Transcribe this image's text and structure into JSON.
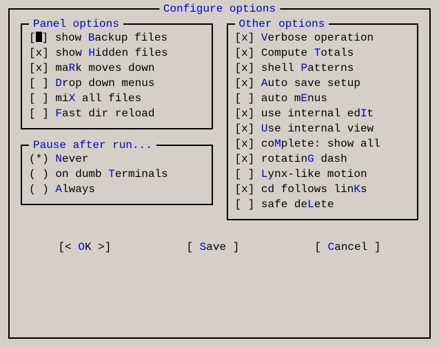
{
  "title": "Configure options",
  "panel": {
    "title": "Panel options",
    "items": [
      {
        "checked": true,
        "pre": "show ",
        "hot": "B",
        "post": "ackup files",
        "cursor": true
      },
      {
        "checked": true,
        "pre": "show ",
        "hot": "H",
        "post": "idden files"
      },
      {
        "checked": true,
        "pre": "ma",
        "hot": "R",
        "post": "k moves down"
      },
      {
        "checked": false,
        "pre": "",
        "hot": "D",
        "post": "rop down menus"
      },
      {
        "checked": false,
        "pre": "mi",
        "hot": "X",
        "post": " all files"
      },
      {
        "checked": false,
        "pre": "",
        "hot": "F",
        "post": "ast dir reload"
      }
    ]
  },
  "pause": {
    "title": "Pause after run...",
    "items": [
      {
        "selected": true,
        "pre": "",
        "hot": "N",
        "post": "ever"
      },
      {
        "selected": false,
        "pre": "on dumb ",
        "hot": "T",
        "post": "erminals"
      },
      {
        "selected": false,
        "pre": "",
        "hot": "A",
        "post": "lways"
      }
    ]
  },
  "other": {
    "title": "Other options",
    "items": [
      {
        "checked": true,
        "pre": "",
        "hot": "V",
        "post": "erbose operation"
      },
      {
        "checked": true,
        "pre": "Compute ",
        "hot": "T",
        "post": "otals"
      },
      {
        "checked": true,
        "pre": "shell ",
        "hot": "P",
        "post": "atterns"
      },
      {
        "checked": true,
        "pre": "",
        "hot": "A",
        "post": "uto save setup"
      },
      {
        "checked": false,
        "pre": "auto m",
        "hot": "E",
        "post": "nus"
      },
      {
        "checked": true,
        "pre": "use internal ed",
        "hot": "I",
        "post": "t"
      },
      {
        "checked": true,
        "pre": "",
        "hot": "U",
        "post": "se internal view"
      },
      {
        "checked": true,
        "pre": "co",
        "hot": "M",
        "post": "plete: show all"
      },
      {
        "checked": true,
        "pre": "rotatin",
        "hot": "G",
        "post": " dash"
      },
      {
        "checked": false,
        "pre": "",
        "hot": "L",
        "post": "ynx-like motion"
      },
      {
        "checked": true,
        "pre": "cd follows lin",
        "hot": "K",
        "post": "s"
      },
      {
        "checked": false,
        "pre": "safe de",
        "hot": "L",
        "post": "ete"
      }
    ]
  },
  "buttons": {
    "ok": {
      "open": "[< ",
      "hot": "O",
      "rest": "K",
      "close": " >]"
    },
    "save": {
      "open": "[ ",
      "hot": "S",
      "rest": "ave",
      "close": " ]"
    },
    "cancel": {
      "open": "[ ",
      "hot": "C",
      "rest": "ancel",
      "close": " ]"
    }
  }
}
